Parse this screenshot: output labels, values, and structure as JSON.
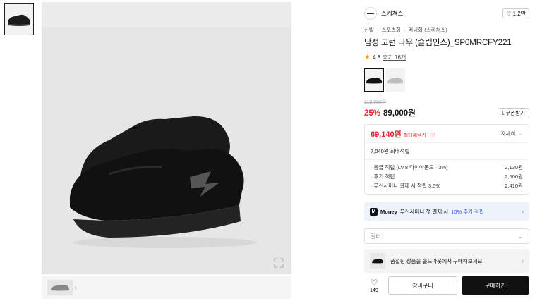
{
  "thumbnails": [
    {
      "alt": "shoe-thumbnail-1"
    }
  ],
  "brand": {
    "name": "스케쳐스"
  },
  "likes_top": "1.2만",
  "breadcrumb": [
    "신발",
    "스포츠화",
    "러닝화 (스케쳐스)"
  ],
  "product_title": "남성 고런 나우 (슬립인스)_SP0MRCFY221",
  "rating": {
    "score": "4.8",
    "reviews": "후기 16개"
  },
  "price": {
    "original": "119,000원",
    "discount": "25%",
    "sale": "89,000원",
    "coupon_label": "쿠폰받기"
  },
  "benefit": {
    "max_price": "69,140원",
    "max_label": "최대혜택가",
    "detail_label": "자세히",
    "points_head": "7,040원 최대적립",
    "points": [
      {
        "label": "· 등급 적립 (LV.8 다이아몬드 · 3%)",
        "value": "2,130원"
      },
      {
        "label": "· 후기 적립",
        "value": "2,500원"
      },
      {
        "label": "· 무신사머니 결제 시 적립 3.5%",
        "value": "2,410원"
      }
    ]
  },
  "money": {
    "badge": "M",
    "brand": "Money",
    "text": "무신사머니 첫 결제 시",
    "highlight": "10% 추가 적립"
  },
  "option_select": {
    "placeholder": "컬러"
  },
  "soldout_notice": "품절된 상품을 솔드아웃에서 구매해보세요.",
  "bottom": {
    "wish_count": "149",
    "cart_label": "장바구니",
    "buy_label": "구매하기"
  },
  "colors": {
    "accent_red": "#e3262f",
    "money_blue": "#3163e0",
    "star": "#f2a600"
  }
}
